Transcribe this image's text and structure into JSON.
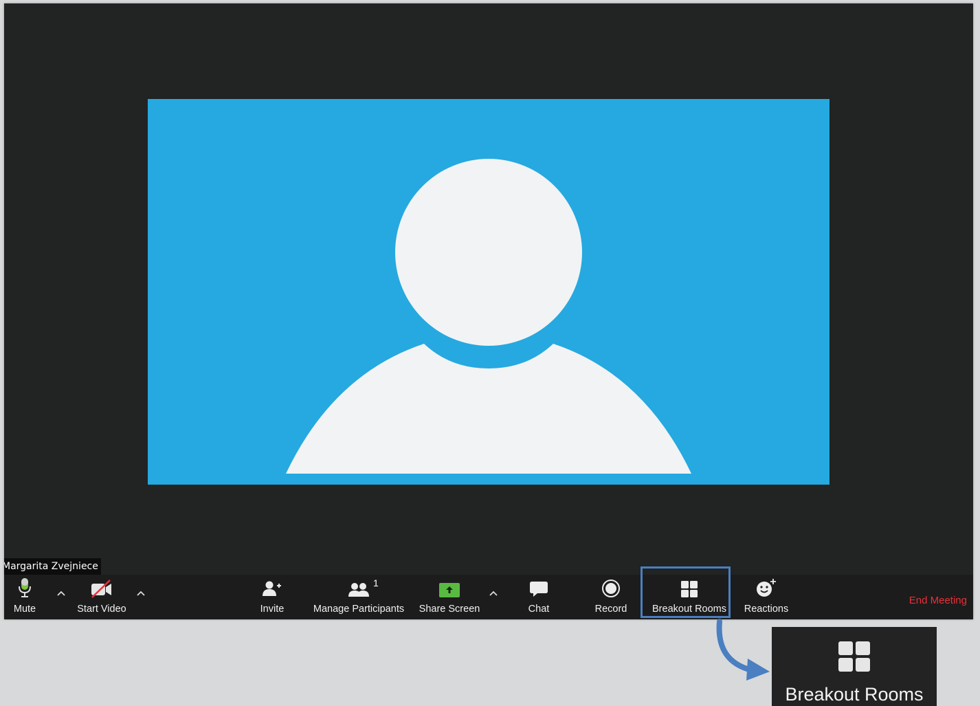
{
  "participant": {
    "name": "Margarita Zvejniece"
  },
  "toolbar": {
    "mute_label": "Mute",
    "start_video_label": "Start Video",
    "invite_label": "Invite",
    "manage_participants_label": "Manage Participants",
    "participant_count": "1",
    "share_screen_label": "Share Screen",
    "chat_label": "Chat",
    "record_label": "Record",
    "breakout_rooms_label": "Breakout Rooms",
    "reactions_label": "Reactions",
    "end_meeting_label": "End Meeting"
  },
  "callout": {
    "label": "Breakout Rooms"
  },
  "colors": {
    "window_bg": "#222323",
    "video_bg": "#25a9e0",
    "avatar": "#f2f3f4",
    "share_green": "#5ab942",
    "end_meeting_red": "#e8313a",
    "highlight_blue": "#4a7fc1",
    "page_bg": "#d8d9db"
  },
  "icons": {
    "mute": "microphone-icon",
    "video": "video-off-icon",
    "invite": "add-person-icon",
    "participants": "people-icon",
    "share": "share-screen-icon",
    "chat": "chat-bubble-icon",
    "record": "record-icon",
    "breakout": "grid-icon",
    "reactions": "smiley-plus-icon",
    "arrow": "curved-arrow-icon"
  }
}
